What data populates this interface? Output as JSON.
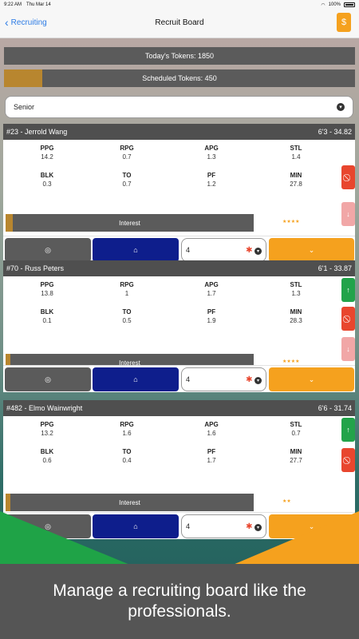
{
  "status_bar": {
    "time": "9:22 AM",
    "date": "Thu Mar 14",
    "battery": "100%"
  },
  "nav": {
    "back_label": "Recruiting",
    "title": "Recruit Board",
    "action_icon": "coin-icon"
  },
  "tokens": {
    "today_label": "Today's Tokens: 1850",
    "today_fill_fraction": 0.0,
    "scheduled_label": "Scheduled Tokens: 450",
    "scheduled_fill_fraction": 0.11
  },
  "filter": {
    "selected": "Senior"
  },
  "stat_labels": {
    "ppg": "PPG",
    "rpg": "RPG",
    "apg": "APG",
    "stl": "STL",
    "blk": "BLK",
    "to": "TO",
    "pf": "PF",
    "min": "MIN"
  },
  "players": [
    {
      "name": "#23 - Jerrold Wang",
      "info": "6'3 - 34.82",
      "stats": {
        "ppg": "14.2",
        "rpg": "0.7",
        "apg": "1.3",
        "stl": "1.4",
        "blk": "0.3",
        "to": "0.7",
        "pf": "1.2",
        "min": "27.8"
      },
      "interest_label": "Interest",
      "interest_fraction": 0.03,
      "stars": "★★★★",
      "star_count": 4.5,
      "token_input": "4"
    },
    {
      "name": "#70 - Russ Peters",
      "info": "6'1 - 33.87",
      "stats": {
        "ppg": "13.8",
        "rpg": "1",
        "apg": "1.7",
        "stl": "1.3",
        "blk": "0.1",
        "to": "0.5",
        "pf": "1.9",
        "min": "28.3"
      },
      "interest_label": "Interest",
      "interest_fraction": 0.02,
      "stars": "★★★★",
      "star_count": 4,
      "token_input": "4"
    },
    {
      "name": "#482 - Elmo Wainwright",
      "info": "6'6 - 31.74",
      "stats": {
        "ppg": "13.2",
        "rpg": "1.6",
        "apg": "1.6",
        "stl": "0.7",
        "blk": "0.6",
        "to": "0.4",
        "pf": "1.7",
        "min": "27.7"
      },
      "interest_label": "Interest",
      "interest_fraction": 0.02,
      "stars": "★★",
      "star_count": 2.5,
      "token_input": "4"
    }
  ],
  "caption": "Manage a recruiting board like the professionals.",
  "colors": {
    "accent_orange": "#f5a11e",
    "navy": "#0e1e8c",
    "red": "#e8462e",
    "green": "#22a34a",
    "gold": "#b8862f"
  }
}
